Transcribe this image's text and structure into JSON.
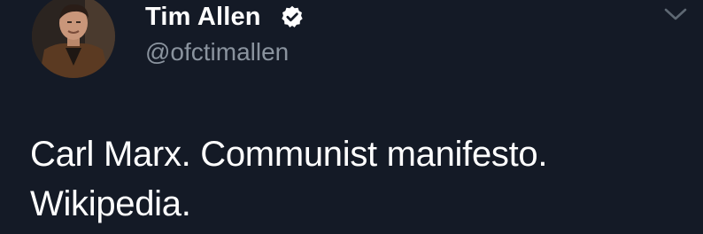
{
  "tweet": {
    "author": {
      "display_name": "Tim Allen",
      "handle": "@ofctimallen",
      "verified": true
    },
    "text_lines": [
      "Carl Marx. Communist manifesto.",
      "Wikipedia."
    ],
    "icons": {
      "verified": "verified-badge-icon",
      "menu": "chevron-down-icon"
    }
  },
  "colors": {
    "background": "#141a26",
    "secondary_text": "#8a939e",
    "primary_text": "#ffffff"
  }
}
